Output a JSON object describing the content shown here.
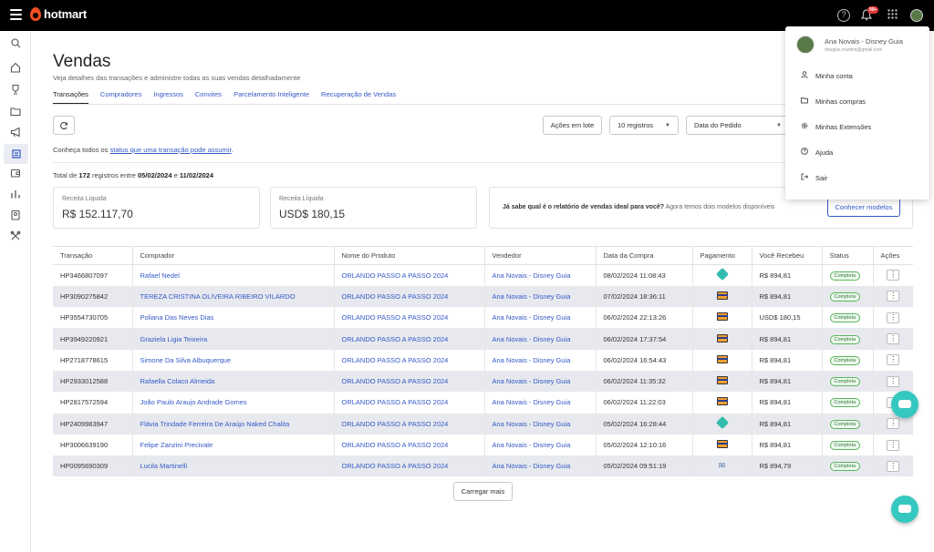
{
  "brand": {
    "name": "hotmart",
    "accent": "#f04e23",
    "link_color": "#3559c7"
  },
  "topbar": {
    "help_icon": "?",
    "notification_badge": "99+"
  },
  "page": {
    "title": "Vendas",
    "subtitle": "Veja detalhes das transações e administre todas as suas vendas detalhadamente",
    "tabs": [
      "Transações",
      "Compradores",
      "Ingressos",
      "Convites",
      "Parcelamento Inteligente",
      "Recuperação de Vendas"
    ]
  },
  "toolbar": {
    "bulk_actions": "Ações em lote",
    "page_size": "10 registros",
    "date_filter": "Data do Pedido"
  },
  "info": {
    "prefix": "Conheça todos os ",
    "link": "status que uma transação pode assumir",
    "suffix": "."
  },
  "total": {
    "prefix": "Total de ",
    "count": "172",
    "middle": " registros entre ",
    "start": "05/02/2024",
    "and": " e ",
    "end": "11/02/2024"
  },
  "cards": [
    {
      "label": "Receita Líquida",
      "value": "R$ 152.117,70"
    },
    {
      "label": "Receita Líquida",
      "value": "USD$ 180,15"
    }
  ],
  "promo": {
    "bold": "Já sabe qual é o relatório de vendas ideal para você?",
    "text": " Agora temos dois modelos disponíveis",
    "button": "Conhecer modelos"
  },
  "table": {
    "headers": [
      "Transação",
      "Comprador",
      "Nome do Produto",
      "Vendedor",
      "Data da Compra",
      "Pagamento",
      "Você Recebeu",
      "Status",
      "Ações"
    ],
    "rows": [
      {
        "id": "HP3466807097",
        "buyer": "Rafael Nedel",
        "product": "ORLANDO PASSO A PASSO 2024",
        "seller": "Ana Novais - Disney Guia",
        "date": "08/02/2024 11:08:43",
        "payment": "pix",
        "received": "R$ 894,81",
        "status": "Completa"
      },
      {
        "id": "HP3090275842",
        "buyer": "TEREZA CRISTINA OLIVEIRA RIBEIRO VILARDO",
        "product": "ORLANDO PASSO A PASSO 2024",
        "seller": "Ana Novais - Disney Guia",
        "date": "07/02/2024 18:36:11",
        "payment": "card",
        "received": "R$ 894,81",
        "status": "Completa"
      },
      {
        "id": "HP3554730705",
        "buyer": "Poliana Das Neves Dias",
        "product": "ORLANDO PASSO A PASSO 2024",
        "seller": "Ana Novais - Disney Guia",
        "date": "06/02/2024 22:13:26",
        "payment": "card",
        "received": "USD$ 180,15",
        "status": "Completa"
      },
      {
        "id": "HP3949220921",
        "buyer": "Graziela Ligia Teixeira",
        "product": "ORLANDO PASSO A PASSO 2024",
        "seller": "Ana Novais - Disney Guia",
        "date": "06/02/2024 17:37:54",
        "payment": "card",
        "received": "R$ 894,81",
        "status": "Completa"
      },
      {
        "id": "HP2718778615",
        "buyer": "Simone Da Silva Albuquerque",
        "product": "ORLANDO PASSO A PASSO 2024",
        "seller": "Ana Novais - Disney Guia",
        "date": "06/02/2024 16:54:43",
        "payment": "card",
        "received": "R$ 894,81",
        "status": "Completa"
      },
      {
        "id": "HP2933012588",
        "buyer": "Rafaella Colaco Almeida",
        "product": "ORLANDO PASSO A PASSO 2024",
        "seller": "Ana Novais - Disney Guia",
        "date": "06/02/2024 11:35:32",
        "payment": "card",
        "received": "R$ 894,81",
        "status": "Completa"
      },
      {
        "id": "HP2817572594",
        "buyer": "João Paulo Araujo Andrade Gomes",
        "product": "ORLANDO PASSO A PASSO 2024",
        "seller": "Ana Novais - Disney Guia",
        "date": "06/02/2024 11:22:03",
        "payment": "card",
        "received": "R$ 894,81",
        "status": "Completa"
      },
      {
        "id": "HP2409983947",
        "buyer": "Flávia Trindade Ferreira De Araújo Naked Chalita",
        "product": "ORLANDO PASSO A PASSO 2024",
        "seller": "Ana Novais - Disney Guia",
        "date": "05/02/2024 16:28:44",
        "payment": "pix",
        "received": "R$ 894,81",
        "status": "Completa"
      },
      {
        "id": "HP3006639190",
        "buyer": "Felipe Zanzini Precivale",
        "product": "ORLANDO PASSO A PASSO 2024",
        "seller": "Ana Novais - Disney Guia",
        "date": "05/02/2024 12:10:16",
        "payment": "card",
        "received": "R$ 894,81",
        "status": "Completa"
      },
      {
        "id": "HP0095690309",
        "buyer": "Lucila Martinelli",
        "product": "ORLANDO PASSO A PASSO 2024",
        "seller": "Ana Novais - Disney Guia",
        "date": "05/02/2024 09:51:19",
        "payment": "boleto",
        "received": "R$ 894,79",
        "status": "Completa"
      }
    ]
  },
  "load_more": "Carregar mais",
  "user_menu": {
    "name": "Ana Novais - Disney Guia",
    "email": "douglas.martins@gmail.com",
    "items": [
      "Minha conta",
      "Minhas compras",
      "Minhas Extensões",
      "Ajuda",
      "Sair"
    ]
  }
}
